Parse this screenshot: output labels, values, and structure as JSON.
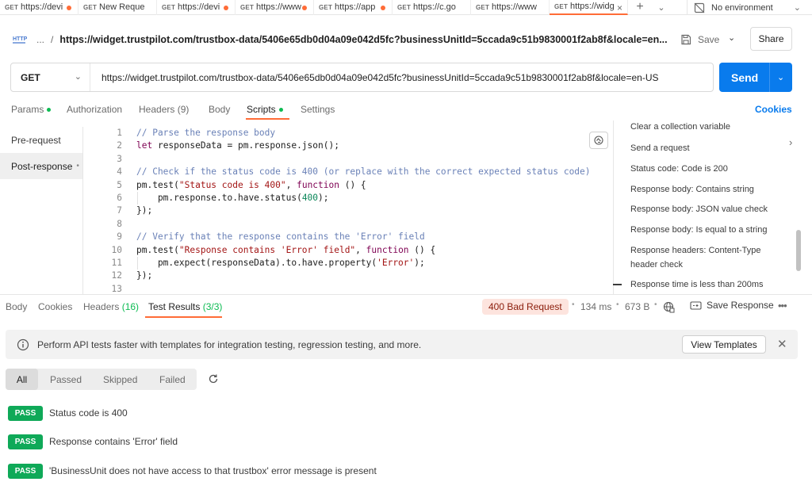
{
  "tabs": [
    {
      "method": "GET",
      "title": "https://devi",
      "dot": true
    },
    {
      "method": "GET",
      "title": "New Reque",
      "dot": false
    },
    {
      "method": "GET",
      "title": "https://devi",
      "dot": true
    },
    {
      "method": "GET",
      "title": "https://www",
      "dot": true
    },
    {
      "method": "GET",
      "title": "https://app",
      "dot": true
    },
    {
      "method": "GET",
      "title": "https://c.go",
      "dot": false
    },
    {
      "method": "GET",
      "title": "https://www",
      "dot": false
    },
    {
      "method": "GET",
      "title": "https://widg",
      "dot": false,
      "active": true
    }
  ],
  "environment": {
    "label": "No environment"
  },
  "breadcrumb": {
    "ellipsis": "...",
    "separator": "/",
    "url": "https://widget.trustpilot.com/trustbox-data/5406e65db0d04a09e042d5fc?businessUnitId=5ccada9c51b9830001f2ab8f&locale=en..."
  },
  "header_actions": {
    "save_label": "Save",
    "share_label": "Share"
  },
  "request": {
    "method": "GET",
    "url": "https://widget.trustpilot.com/trustbox-data/5406e65db0d04a09e042d5fc?businessUnitId=5ccada9c51b9830001f2ab8f&locale=en-US",
    "send_label": "Send"
  },
  "request_tabs": {
    "params": "Params",
    "authorization": "Authorization",
    "headers": "Headers (9)",
    "body": "Body",
    "scripts": "Scripts",
    "settings": "Settings",
    "cookies": "Cookies"
  },
  "script_side": {
    "pre_request": "Pre-request",
    "post_response": "Post-response"
  },
  "code_lines": [
    {
      "n": "1",
      "parts": [
        [
          "cm",
          "// Parse the response body"
        ]
      ]
    },
    {
      "n": "2",
      "parts": [
        [
          "kw",
          "let"
        ],
        [
          "pl",
          " responseData = pm.response.json();"
        ]
      ]
    },
    {
      "n": "3",
      "parts": []
    },
    {
      "n": "4",
      "parts": [
        [
          "cm",
          "// Check if the status code is 400 (or replace with the correct expected status code)"
        ]
      ]
    },
    {
      "n": "5",
      "parts": [
        [
          "pl",
          "pm.test("
        ],
        [
          "st",
          "\"Status code is 400\""
        ],
        [
          "pl",
          ", "
        ],
        [
          "kw",
          "function"
        ],
        [
          "pl",
          " () {"
        ]
      ]
    },
    {
      "n": "6",
      "parts": [
        [
          "pl",
          "    pm.response.to.have.status("
        ],
        [
          "nm",
          "400"
        ],
        [
          "pl",
          ");"
        ]
      ]
    },
    {
      "n": "7",
      "parts": [
        [
          "pl",
          "});"
        ]
      ]
    },
    {
      "n": "8",
      "parts": []
    },
    {
      "n": "9",
      "parts": [
        [
          "cm",
          "// Verify that the response contains the 'Error' field"
        ]
      ]
    },
    {
      "n": "10",
      "parts": [
        [
          "pl",
          "pm.test("
        ],
        [
          "st",
          "\"Response contains 'Error' field\""
        ],
        [
          "pl",
          ", "
        ],
        [
          "kw",
          "function"
        ],
        [
          "pl",
          " () {"
        ]
      ]
    },
    {
      "n": "11",
      "parts": [
        [
          "pl",
          "    pm.expect(responseData).to.have.property("
        ],
        [
          "st",
          "'Error'"
        ],
        [
          "pl",
          ");"
        ]
      ]
    },
    {
      "n": "12",
      "parts": [
        [
          "pl",
          "});"
        ]
      ]
    },
    {
      "n": "13",
      "parts": []
    }
  ],
  "snippets": [
    "Clear a collection variable",
    "Send a request",
    "Status code: Code is 200",
    "Response body: Contains string",
    "Response body: JSON value check",
    "Response body: Is equal to a string",
    "Response headers: Content-Type header check",
    "Response time is less than 200ms"
  ],
  "response_tabs": {
    "body": "Body",
    "cookies": "Cookies",
    "headers_label": "Headers",
    "headers_count": "(16)",
    "test_results_label": "Test Results",
    "test_results_count": "(3/3)"
  },
  "response_meta": {
    "status": "400 Bad Request",
    "time": "134 ms",
    "size": "673 B",
    "save_response": "Save Response",
    "more": "•••"
  },
  "banner": {
    "text": "Perform API tests faster with templates for integration testing, regression testing, and more.",
    "button": "View Templates"
  },
  "filters": [
    "All",
    "Passed",
    "Skipped",
    "Failed"
  ],
  "results": [
    {
      "badge": "PASS",
      "text": "Status code is 400"
    },
    {
      "badge": "PASS",
      "text": "Response contains 'Error' field"
    },
    {
      "badge": "PASS",
      "text": "'BusinessUnit does not have access to that trustbox' error message is present"
    }
  ],
  "colors": {
    "accent_orange": "#ff6c37",
    "send_blue": "#097bed",
    "pass_green": "#0fa958",
    "dot_green": "#0cbb52",
    "bad_request_bg": "#fde4de"
  }
}
